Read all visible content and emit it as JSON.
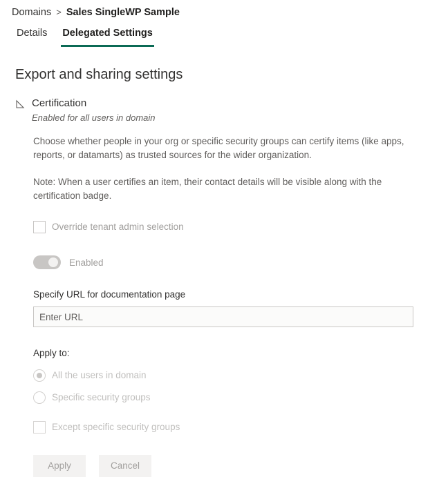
{
  "colors": {
    "accent": "#0b6a55",
    "text": "#323130",
    "secondary_text": "#605e5c",
    "disabled_text": "#a19f9d",
    "disabled_faint_text": "#c0bfbd",
    "border": "#c8c6c4",
    "button_bg": "#f3f2f1",
    "input_bg": "#fbfbfa",
    "toggle_track": "#c8c6c4",
    "toggle_knob": "#f3f2f1"
  },
  "breadcrumb": {
    "root_label": "Domains",
    "separator": ">",
    "current_label": "Sales SingleWP Sample"
  },
  "tabs": [
    {
      "label": "Details",
      "active": false
    },
    {
      "label": "Delegated Settings",
      "active": true
    }
  ],
  "page": {
    "heading": "Export and sharing settings"
  },
  "group": {
    "collapse_icon": "collapse-triangle-icon",
    "title": "Certification",
    "subtitle": "Enabled for all users in domain",
    "description_1": "Choose whether people in your org or specific security groups can certify items (like apps, reports, or datamarts) as trusted sources for the wider organization.",
    "description_2": "Note: When a user certifies an item, their contact details will be visible along with the certification badge."
  },
  "override": {
    "label": "Override tenant admin selection",
    "checked": false,
    "disabled": true
  },
  "toggle": {
    "label": "Enabled",
    "on": true,
    "disabled": true
  },
  "url_field": {
    "label": "Specify URL for documentation page",
    "placeholder": "Enter URL",
    "value": ""
  },
  "apply_to": {
    "label": "Apply to:",
    "options": [
      {
        "label": "All the users in domain",
        "selected": true
      },
      {
        "label": "Specific security groups",
        "selected": false
      }
    ],
    "except_checkbox": {
      "label": "Except specific security groups",
      "checked": false
    }
  },
  "actions": {
    "apply_label": "Apply",
    "cancel_label": "Cancel"
  }
}
